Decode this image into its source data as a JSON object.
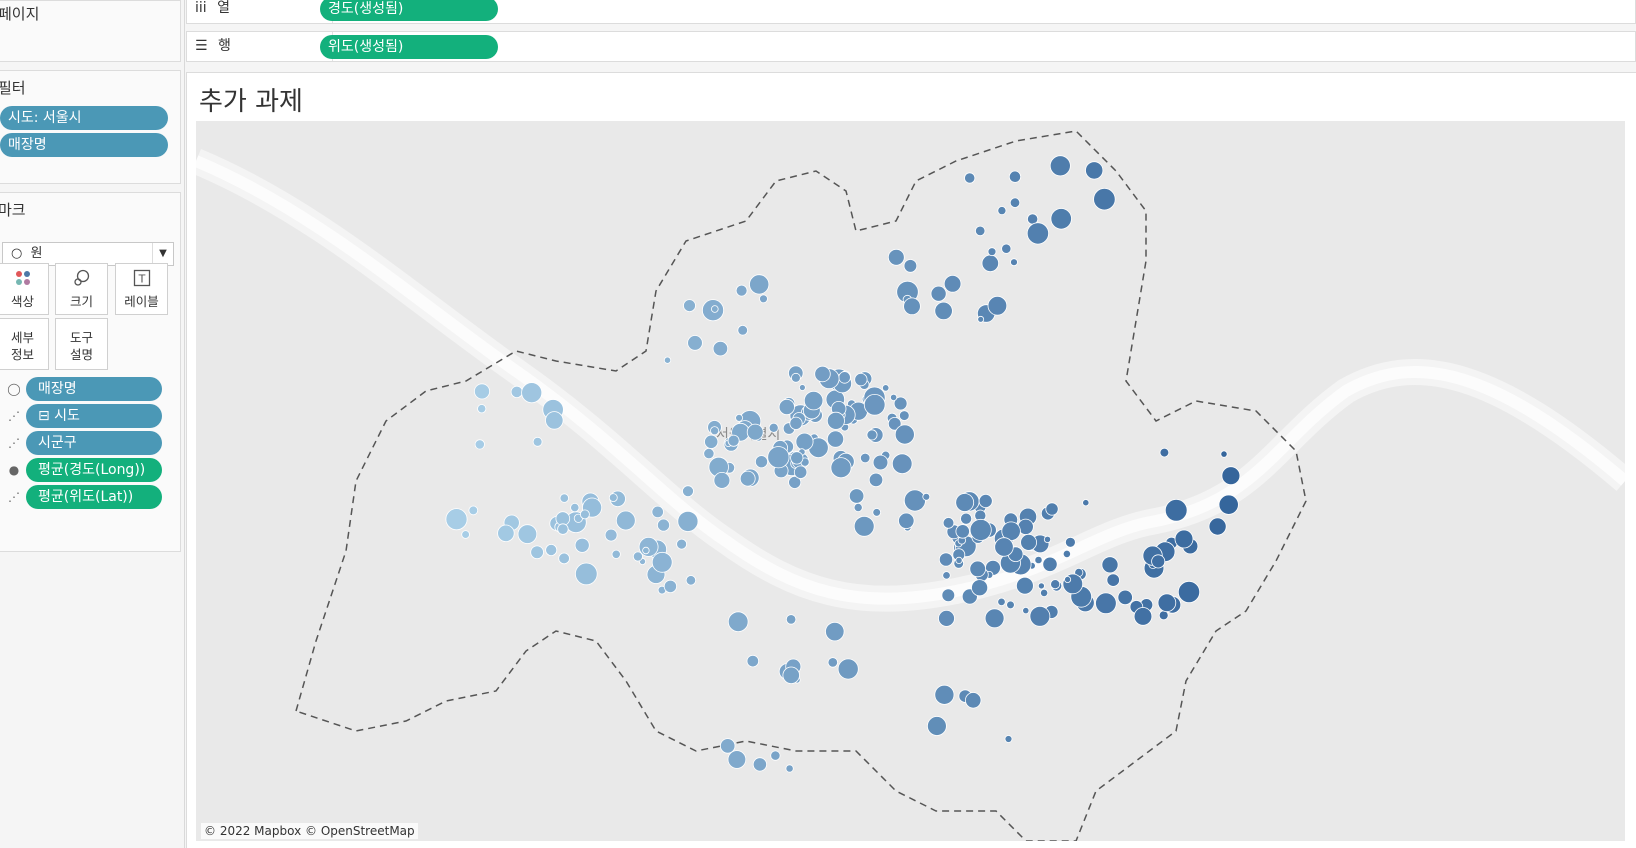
{
  "pages": {
    "title": "페이지"
  },
  "columns_shelf": {
    "label": "열",
    "icon": "columns-icon",
    "pill": "경도(생성됨)"
  },
  "rows_shelf": {
    "label": "행",
    "icon": "rows-icon",
    "pill": "위도(생성됨)"
  },
  "filters": {
    "title": "필터",
    "items": [
      "시도: 서울시",
      "매장명"
    ]
  },
  "marks": {
    "title": "마크",
    "mark_type": "원",
    "buttons": {
      "color": "색상",
      "size": "크기",
      "label": "레이블",
      "detail": "세부\n정보",
      "tooltip": "도구\n설명"
    },
    "fields": [
      {
        "role": "size",
        "icon": "size-icon",
        "label": "매장명"
      },
      {
        "role": "detail",
        "icon": "detail-icon",
        "label": "⊟ 시도"
      },
      {
        "role": "detail",
        "icon": "detail-icon",
        "label": "시군구"
      },
      {
        "role": "color",
        "icon": "color-icon",
        "label": "평균(경도(Long))"
      },
      {
        "role": "detail",
        "icon": "detail-icon",
        "label": "평균(위도(Lat))"
      }
    ]
  },
  "viz": {
    "title": "추가 과제",
    "map_label": "서울특별시",
    "attribution": "© 2022 Mapbox © OpenStreetMap"
  },
  "colors": {
    "pill_blue": "#4b98b6",
    "pill_green": "#13b07c",
    "map_bg": "#e9e9e9",
    "dot_light": "#a7cde6",
    "dot_dark": "#2e5f97"
  }
}
